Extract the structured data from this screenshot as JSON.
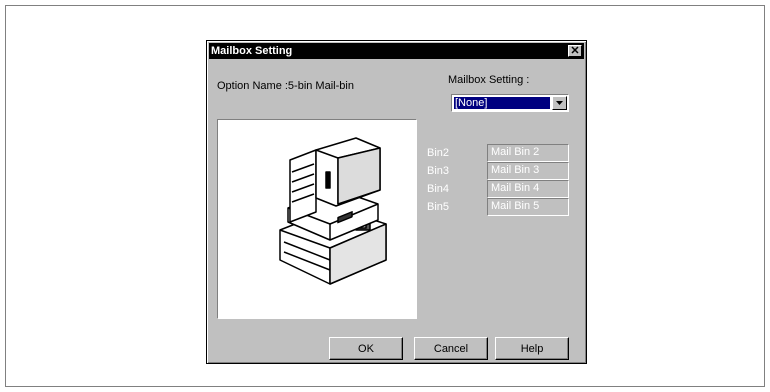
{
  "dialog": {
    "title": "Mailbox Setting",
    "close_label": "✕",
    "option_name": "Option Name :5-bin Mail-bin",
    "mailbox_setting_label": "Mailbox Setting :",
    "mailbox_setting_value": "[None]",
    "bins": [
      {
        "label": "Bin2",
        "value": "Mail Bin 2"
      },
      {
        "label": "Bin3",
        "value": "Mail Bin 3"
      },
      {
        "label": "Bin4",
        "value": "Mail Bin 4"
      },
      {
        "label": "Bin5",
        "value": "Mail Bin 5"
      }
    ],
    "buttons": {
      "ok": "OK",
      "cancel": "Cancel",
      "help": "Help"
    }
  },
  "icons": {
    "close": "close-icon",
    "dropdown": "chevron-down-icon",
    "printer": "printer-mailbin-illustration"
  }
}
